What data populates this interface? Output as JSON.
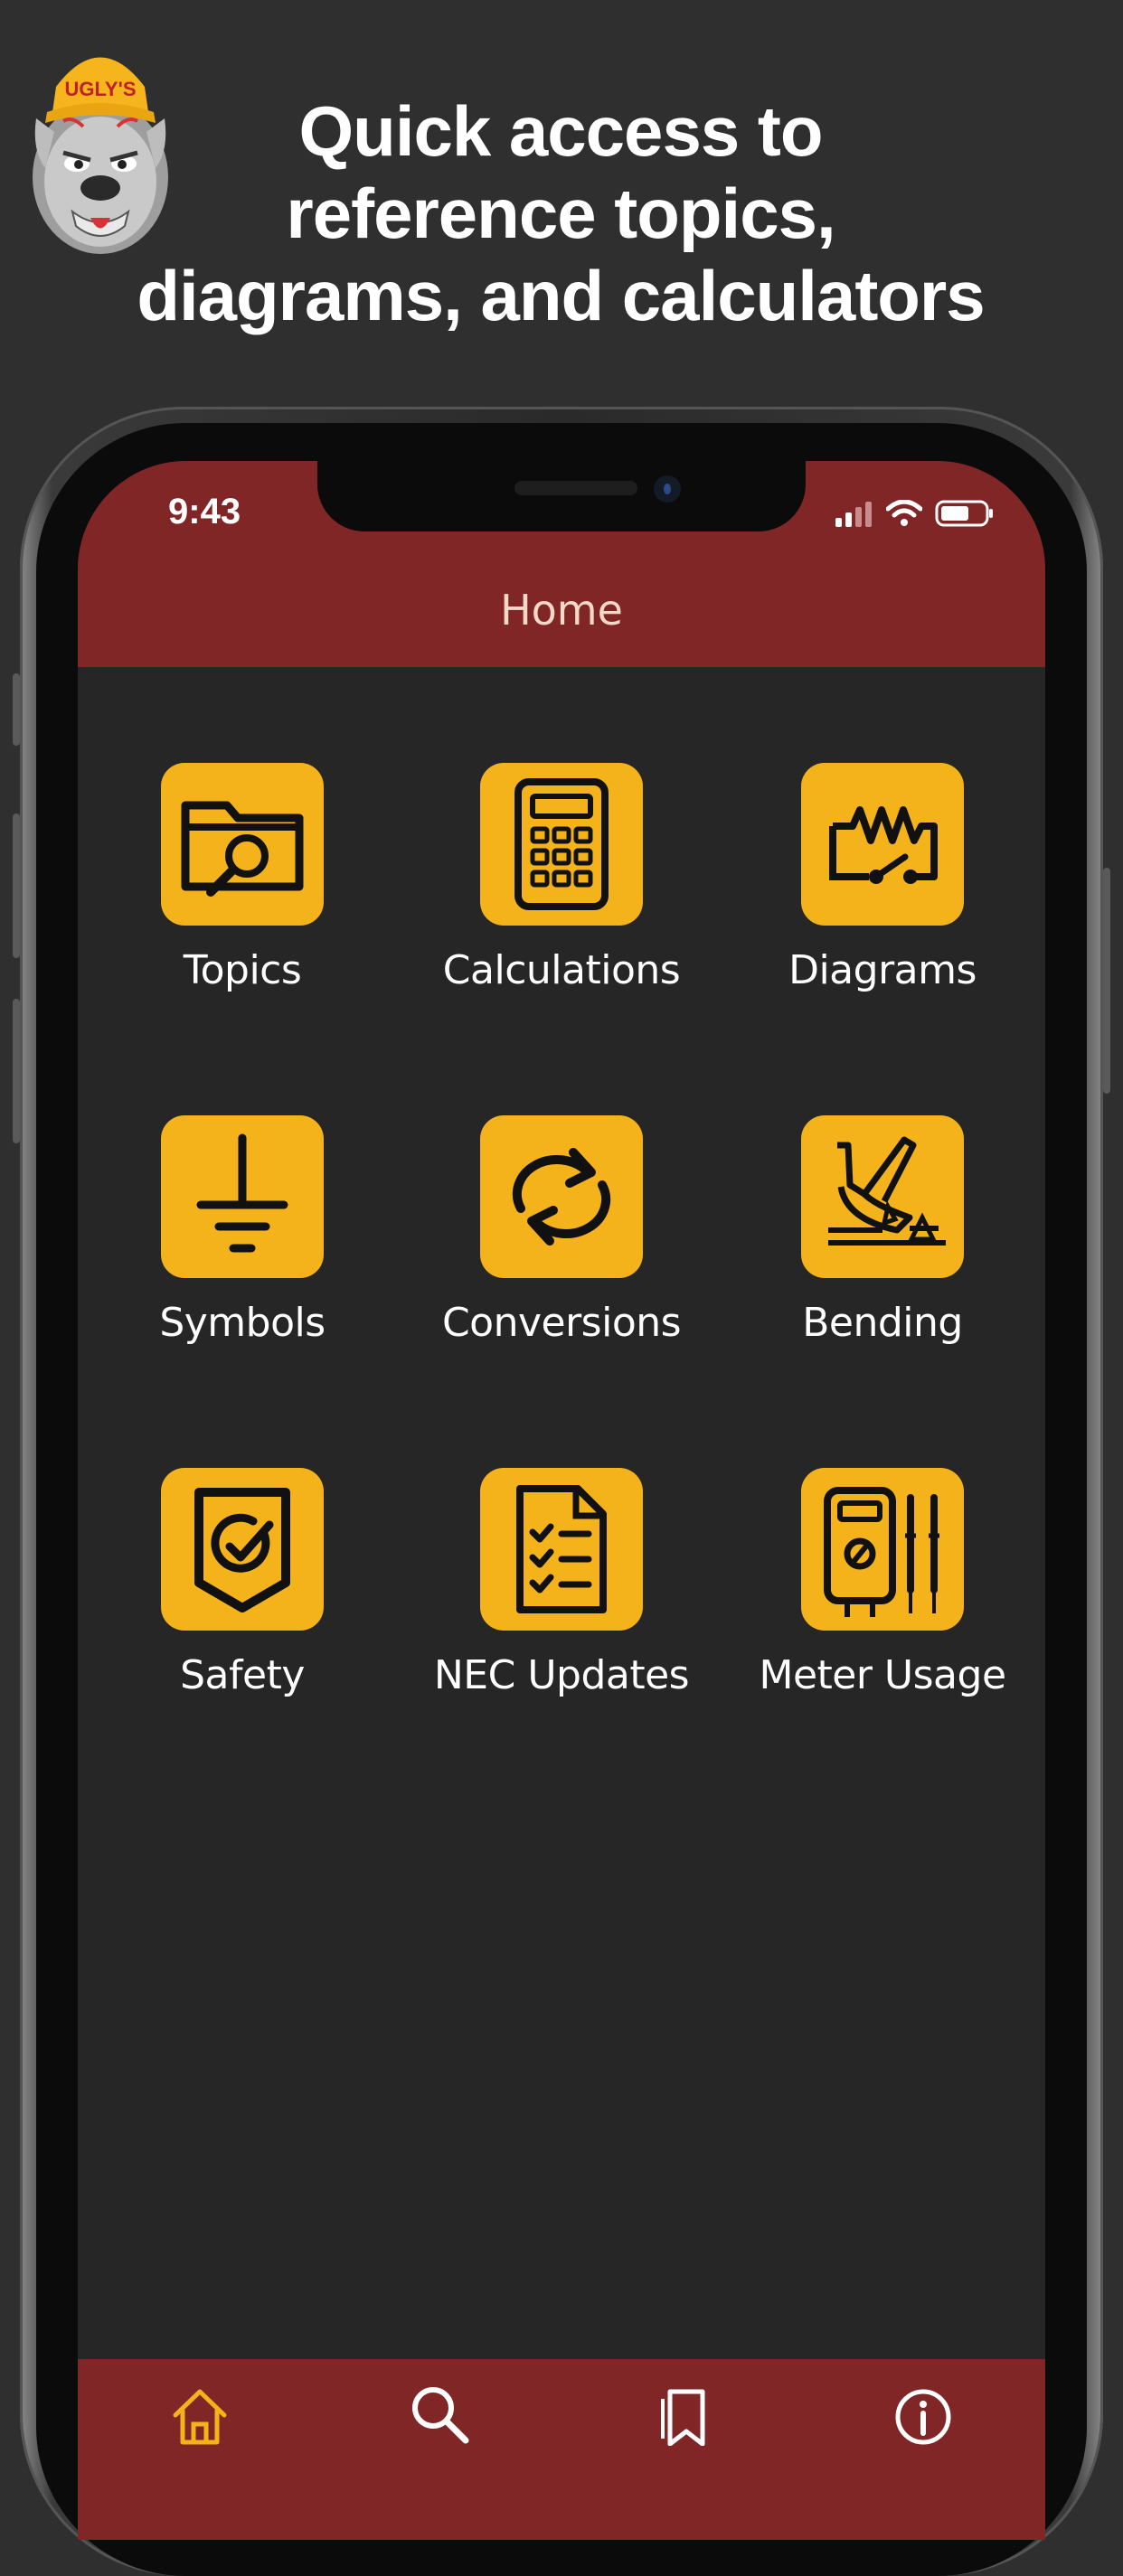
{
  "headline": {
    "lines": [
      "Quick access to",
      "reference topics,",
      "diagrams, and calculators"
    ]
  },
  "logo": {
    "cap_text": "UGLY'S"
  },
  "status_bar": {
    "time": "9:43",
    "icons": [
      "signal-icon",
      "wifi-icon",
      "battery-icon"
    ]
  },
  "nav": {
    "title": "Home"
  },
  "grid": [
    {
      "label": "Topics",
      "icon": "folder-search-icon"
    },
    {
      "label": "Calculations",
      "icon": "calculator-icon"
    },
    {
      "label": "Diagrams",
      "icon": "circuit-diagram-icon"
    },
    {
      "label": "Symbols",
      "icon": "ground-symbol-icon"
    },
    {
      "label": "Conversions",
      "icon": "convert-arrows-icon"
    },
    {
      "label": "Bending",
      "icon": "conduit-bender-icon"
    },
    {
      "label": "Safety",
      "icon": "safety-shield-icon"
    },
    {
      "label": "NEC Updates",
      "icon": "checklist-document-icon"
    },
    {
      "label": "Meter Usage",
      "icon": "multimeter-icon"
    }
  ],
  "tabbar": {
    "items": [
      {
        "name": "home",
        "icon": "home-icon",
        "active": true
      },
      {
        "name": "search",
        "icon": "search-icon",
        "active": false
      },
      {
        "name": "bookmarks",
        "icon": "bookmark-icon",
        "active": false
      },
      {
        "name": "info",
        "icon": "info-icon",
        "active": false
      }
    ]
  },
  "colors": {
    "background": "#2f2f2f",
    "bar": "#812627",
    "screen": "#262626",
    "tile": "#f4b21b",
    "active_tab": "#f4b21b"
  }
}
